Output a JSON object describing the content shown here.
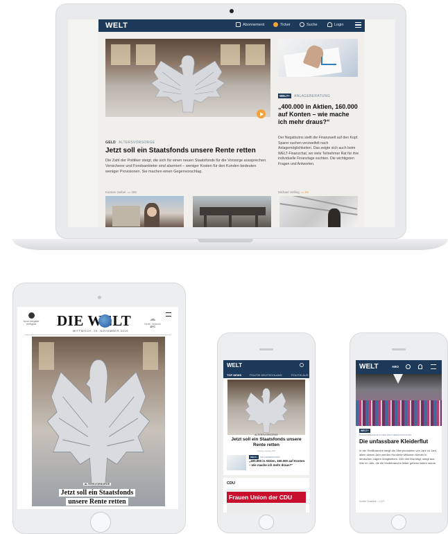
{
  "laptop": {
    "logo": "WELT",
    "nav": [
      "Abonnement",
      "Ticker",
      "Suche",
      "Login"
    ],
    "hero": {
      "kicker": "GELD",
      "kicker_sub": "ALTERSVORSORGE",
      "headline": "Jetzt soll ein Staatsfonds unsere Rente retten",
      "teaser": "Die Zahl der Politiker steigt, die sich für einen neuen Staatsfonds für die Vorsorge aussprechen. Versicherer und Fondsanbieter sind alarmiert – weniger Kosten für den Kunden bedeuten weniger Provisionen. Sie machen einen Gegenvorschlag.",
      "author": "Karsten Seibel",
      "comments": "495"
    },
    "side": {
      "tag": "WELT+",
      "kicker": "ANLAGEBERATUNG",
      "headline": "„400.000 in Aktien, 160.000 auf Konten – wie mache ich mehr draus?“",
      "teaser": "Der Negativzins stellt die Finanzwelt auf den Kopf. Sparer suchen verzweifelt nach Anlagemöglichkeiten. Das zeigte sich auch beim WELT-Finanzchat, wo viele Teilnehmer Rat für ihre individuelle Finanzlage suchten. Die wichtigsten Fragen und Antworten.",
      "author": "Michael Höfling",
      "comments": "99"
    }
  },
  "tablet": {
    "logo": "DIE WELT",
    "date": "MITTWOCH, 20. NOVEMBER 2019",
    "left_label": "Neue Ausgabe verfügbar",
    "right_label": "Berlin, bedeckt",
    "temp": "10°C",
    "caption_kicker": "ALTERSVORSORGE",
    "caption_line1": "Jetzt soll ein Staatsfonds",
    "caption_line2": "unsere Rente retten"
  },
  "phone1": {
    "logo": "WELT",
    "tabs": [
      "TOP NEWS",
      "POLITIK DEUTSCHLAND",
      "POLITIK AUS"
    ],
    "kicker": "ALTERSVORSORGE",
    "headline": "Jetzt soll ein Staatsfonds unsere Rente retten",
    "meta": "Karsten Seibel  495",
    "item_tag": "WELT+",
    "item_kicker": "ANLAGEBERATUNG",
    "item_headline": "„400.000 in Aktien, 160.000 auf Konten – wie mache ich mehr draus?“",
    "section": "CDU",
    "banner": "Frauen Union der CDU"
  },
  "phone2": {
    "logo": "WELT",
    "abo": "ABO",
    "tag": "WELT+",
    "kicker": "FASHIONBRANCHE IN DER WELTVERSCHMUTZUNG",
    "headline": "Die unfassbare Kleiderflut",
    "teaser": "In der Textilbranche steigt die Überproduktion von Jahr zu Jahr, allein dieses Jahr werden Hunderte Millionen Kleider in deutschen Lägern übrigbleiben. Wer drei Mal trägt, steigt aus. Wer im Jahr, die die Modebranche lieber geheim halten würde.",
    "author": "Anette Dowideit",
    "comments": "127"
  },
  "colors": {
    "brand": "#1e3a5a",
    "accent": "#f2a33a"
  }
}
